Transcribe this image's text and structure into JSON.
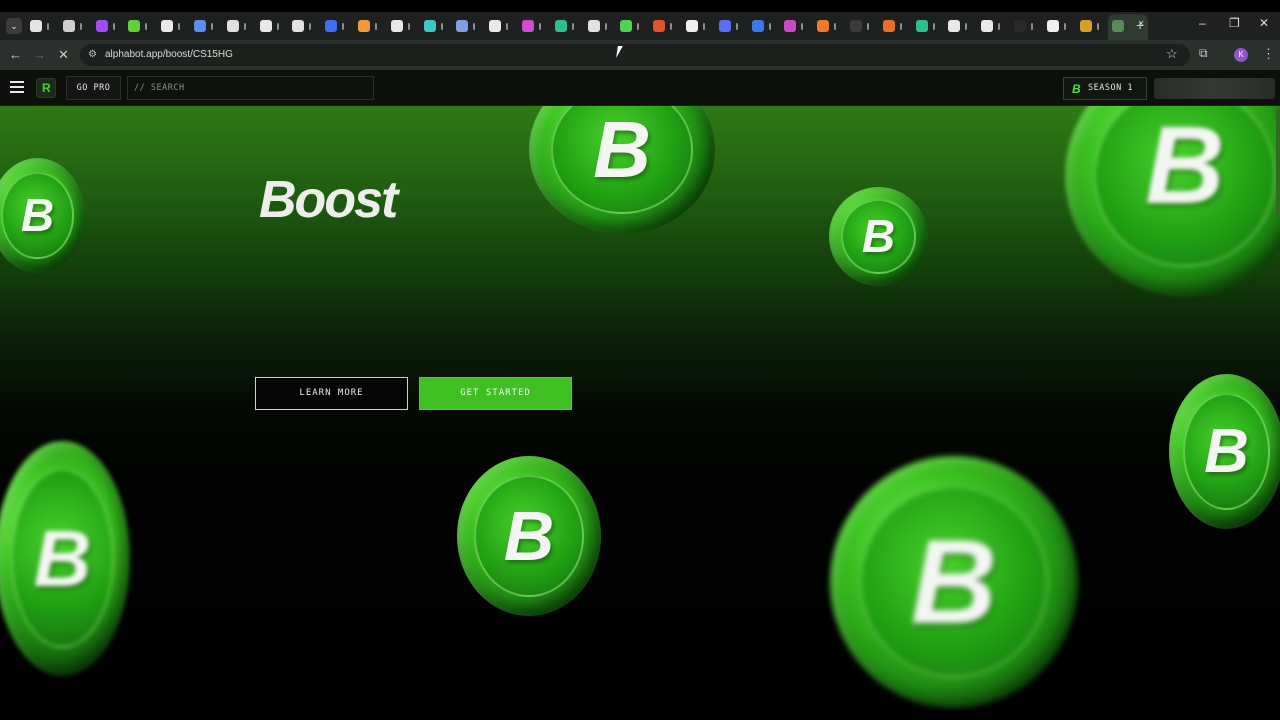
{
  "browser": {
    "tabs_favicon_colors": [
      "#e4e4e4",
      "#cfcfcf",
      "#a14cf5",
      "#5fd23a",
      "#e8e8e8",
      "#5d8df0",
      "#e0e0e0",
      "#e8e8e8",
      "#e0e0e0",
      "#3d6ef5",
      "#f09a3a",
      "#e8e8e8",
      "#3ec7c7",
      "#7ea0e6",
      "#e8e8e8",
      "#d14cd1",
      "#2fbf8f",
      "#e0e0e0",
      "#4fd24f",
      "#e0552c",
      "#f0f0f0",
      "#5a6ff0",
      "#3a7ae6",
      "#c84ac8",
      "#f07a2a",
      "#3a3a3a",
      "#e4702a",
      "#2fbf8f",
      "#e8e8e8",
      "#e8e8e8",
      "#2a2a2a",
      "#f0f0f0",
      "#d4a02a",
      "#5a8a5a"
    ],
    "active_tab_close_icon": "×",
    "new_tab_icon": "+",
    "window_controls": {
      "minimize": "–",
      "restore": "❐",
      "close": "✕"
    },
    "url": "alphabot.app/boost/CS15HG",
    "url_site_info_icon": "tune-icon",
    "back_icon": "←",
    "forward_icon": "→",
    "reload_icon": "✕",
    "bookmark_icon": "☆",
    "extensions_icon": "⧉",
    "profile_initial": "K",
    "menu_icon": "⋮"
  },
  "site_nav": {
    "logo_glyph": "R",
    "go_pro": "GO PRO",
    "search_placeholder": "// SEARCH",
    "season_badge_icon": "B",
    "season_label": "SEASON 1"
  },
  "hero": {
    "brand": "Boost",
    "learn_more": "LEARN MORE",
    "get_started": "GET STARTED",
    "coin_glyph": "B"
  },
  "colors": {
    "accent": "#3fbf22",
    "coin_green": "#22a114",
    "hero_top": "#2e7a14",
    "background": "#000000"
  }
}
